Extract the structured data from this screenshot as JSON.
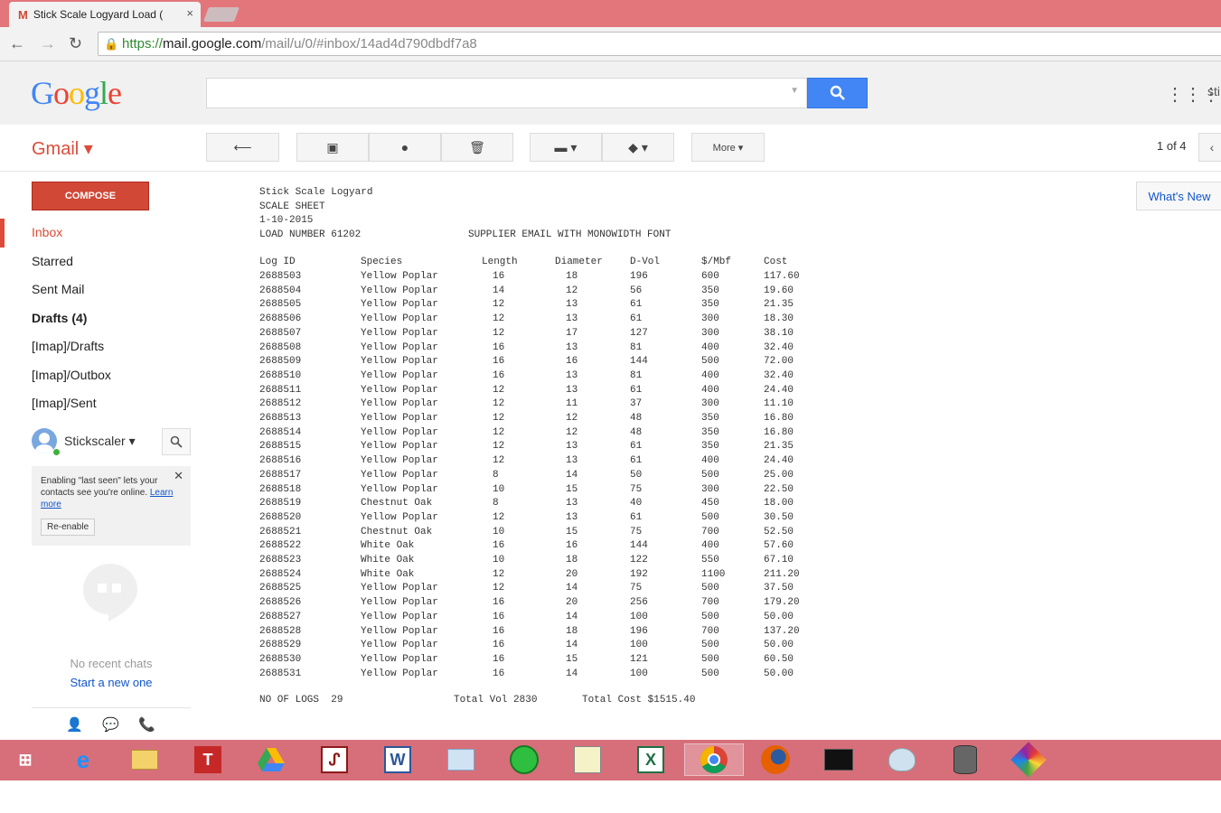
{
  "browser": {
    "tab_title": "Stick Scale Logyard Load (",
    "tab_close": "×",
    "url_scheme": "https://",
    "url_host": "mail.google.com",
    "url_path": "/mail/u/0/#inbox/14ad4d790dbdf7a8"
  },
  "google": {
    "logo": [
      "G",
      "o",
      "o",
      "g",
      "l",
      "e"
    ],
    "search_placeholder": "",
    "user_initial": "sti"
  },
  "gmail": {
    "label": "Gmail ▾",
    "more_label": "More ▾",
    "pager": "1 of 4",
    "whats_new": "What's New"
  },
  "sidebar": {
    "compose": "COMPOSE",
    "items": [
      {
        "label": "Inbox"
      },
      {
        "label": "Starred"
      },
      {
        "label": "Sent Mail"
      },
      {
        "label": "Drafts (4)"
      },
      {
        "label": "[Imap]/Drafts"
      },
      {
        "label": "[Imap]/Outbox"
      },
      {
        "label": "[Imap]/Sent"
      }
    ],
    "chat_user": "Stickscaler ▾",
    "lastseen_text": "Enabling \"last seen\" lets your contacts see you're online.",
    "learn_more": "Learn more",
    "reenable": "Re-enable",
    "no_recent": "No recent chats",
    "start_new": "Start a new one"
  },
  "message": {
    "line1": "Stick Scale Logyard",
    "line2": "SCALE SHEET",
    "line3": "1-10-2015",
    "line4": "LOAD NUMBER 61202",
    "line4b": "SUPPLIER EMAIL WITH MONOWIDTH FONT",
    "columns": [
      "Log ID",
      "Species",
      "Length",
      "Diameter",
      "D-Vol",
      "$/Mbf",
      "Cost"
    ],
    "rows": [
      [
        "2688503",
        "Yellow Poplar",
        "16",
        "18",
        "196",
        "600",
        "117.60"
      ],
      [
        "2688504",
        "Yellow Poplar",
        "14",
        "12",
        "56",
        "350",
        "19.60"
      ],
      [
        "2688505",
        "Yellow Poplar",
        "12",
        "13",
        "61",
        "350",
        "21.35"
      ],
      [
        "2688506",
        "Yellow Poplar",
        "12",
        "13",
        "61",
        "300",
        "18.30"
      ],
      [
        "2688507",
        "Yellow Poplar",
        "12",
        "17",
        "127",
        "300",
        "38.10"
      ],
      [
        "2688508",
        "Yellow Poplar",
        "16",
        "13",
        "81",
        "400",
        "32.40"
      ],
      [
        "2688509",
        "Yellow Poplar",
        "16",
        "16",
        "144",
        "500",
        "72.00"
      ],
      [
        "2688510",
        "Yellow Poplar",
        "16",
        "13",
        "81",
        "400",
        "32.40"
      ],
      [
        "2688511",
        "Yellow Poplar",
        "12",
        "13",
        "61",
        "400",
        "24.40"
      ],
      [
        "2688512",
        "Yellow Poplar",
        "12",
        "11",
        "37",
        "300",
        "11.10"
      ],
      [
        "2688513",
        "Yellow Poplar",
        "12",
        "12",
        "48",
        "350",
        "16.80"
      ],
      [
        "2688514",
        "Yellow Poplar",
        "12",
        "12",
        "48",
        "350",
        "16.80"
      ],
      [
        "2688515",
        "Yellow Poplar",
        "12",
        "13",
        "61",
        "350",
        "21.35"
      ],
      [
        "2688516",
        "Yellow Poplar",
        "12",
        "13",
        "61",
        "400",
        "24.40"
      ],
      [
        "2688517",
        "Yellow Poplar",
        "8",
        "14",
        "50",
        "500",
        "25.00"
      ],
      [
        "2688518",
        "Yellow Poplar",
        "10",
        "15",
        "75",
        "300",
        "22.50"
      ],
      [
        "2688519",
        "Chestnut Oak",
        "8",
        "13",
        "40",
        "450",
        "18.00"
      ],
      [
        "2688520",
        "Yellow Poplar",
        "12",
        "13",
        "61",
        "500",
        "30.50"
      ],
      [
        "2688521",
        "Chestnut Oak",
        "10",
        "15",
        "75",
        "700",
        "52.50"
      ],
      [
        "2688522",
        "White Oak",
        "16",
        "16",
        "144",
        "400",
        "57.60"
      ],
      [
        "2688523",
        "White Oak",
        "10",
        "18",
        "122",
        "550",
        "67.10"
      ],
      [
        "2688524",
        "White Oak",
        "12",
        "20",
        "192",
        "1100",
        "211.20"
      ],
      [
        "2688525",
        "Yellow Poplar",
        "12",
        "14",
        "75",
        "500",
        "37.50"
      ],
      [
        "2688526",
        "Yellow Poplar",
        "16",
        "20",
        "256",
        "700",
        "179.20"
      ],
      [
        "2688527",
        "Yellow Poplar",
        "16",
        "14",
        "100",
        "500",
        "50.00"
      ],
      [
        "2688528",
        "Yellow Poplar",
        "16",
        "18",
        "196",
        "700",
        "137.20"
      ],
      [
        "2688529",
        "Yellow Poplar",
        "16",
        "14",
        "100",
        "500",
        "50.00"
      ],
      [
        "2688530",
        "Yellow Poplar",
        "16",
        "15",
        "121",
        "500",
        "60.50"
      ],
      [
        "2688531",
        "Yellow Poplar",
        "16",
        "14",
        "100",
        "500",
        "50.00"
      ]
    ],
    "footer_logs": "NO OF LOGS  29",
    "footer_vol": "Total Vol 2830",
    "footer_cost": "Total Cost $1515.40"
  },
  "colors": {
    "tabbar": "#e3767b",
    "gmail_red": "#dd4b39",
    "compose": "#d14836",
    "search_blue": "#4285f4",
    "taskbar": "#d66f7a"
  },
  "taskbar_icons": [
    "windows-start-icon",
    "internet-explorer-icon",
    "file-explorer-icon",
    "typora-icon",
    "google-drive-icon",
    "acrobat-icon",
    "word-icon",
    "photos-icon",
    "spotify-icon",
    "notepad-icon",
    "excel-icon",
    "chrome-icon",
    "firefox-icon",
    "terminal-icon",
    "paint-icon",
    "database-icon",
    "app-icon"
  ]
}
